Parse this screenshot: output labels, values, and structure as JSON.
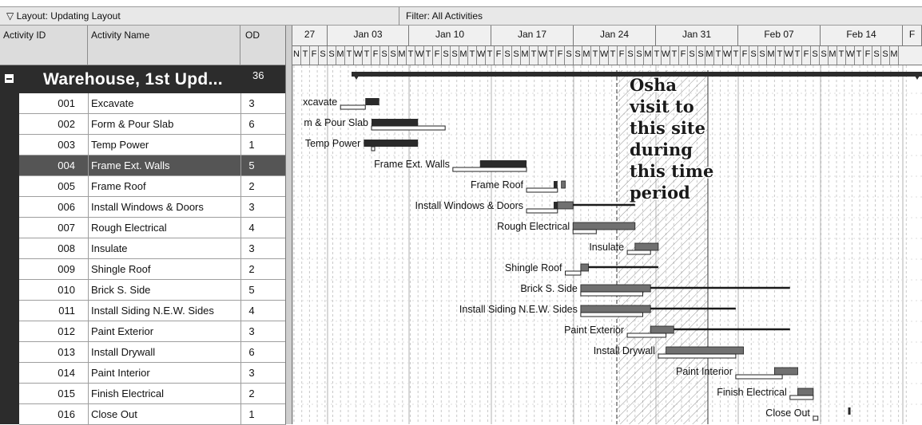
{
  "toolbar": {
    "layout_label": "Layout: Updating Layout",
    "filter_label": "Filter: All Activities"
  },
  "columns": {
    "activity_id": "Activity ID",
    "activity_name": "Activity Name",
    "od": "OD"
  },
  "wbs": {
    "name": "Warehouse, 1st Upd...",
    "od": "36"
  },
  "activities": [
    {
      "id": "001",
      "name": "Excavate",
      "od": "3",
      "bar_label": "xcavate"
    },
    {
      "id": "002",
      "name": "Form & Pour Slab",
      "od": "6",
      "bar_label": "m & Pour Slab"
    },
    {
      "id": "003",
      "name": "Temp Power",
      "od": "1",
      "bar_label": "Temp Power"
    },
    {
      "id": "004",
      "name": "Frame Ext. Walls",
      "od": "5",
      "bar_label": "Frame Ext. Walls"
    },
    {
      "id": "005",
      "name": "Frame Roof",
      "od": "2",
      "bar_label": "Frame Roof"
    },
    {
      "id": "006",
      "name": "Install Windows & Doors",
      "od": "3",
      "bar_label": "Install Windows & Doors"
    },
    {
      "id": "007",
      "name": "Rough Electrical",
      "od": "4",
      "bar_label": "Rough Electrical"
    },
    {
      "id": "008",
      "name": "Insulate",
      "od": "3",
      "bar_label": "Insulate"
    },
    {
      "id": "009",
      "name": "Shingle Roof",
      "od": "2",
      "bar_label": "Shingle Roof"
    },
    {
      "id": "010",
      "name": "Brick S. Side",
      "od": "5",
      "bar_label": "Brick S. Side"
    },
    {
      "id": "011",
      "name": "Install Siding N.E.W. Sides",
      "od": "4",
      "bar_label": "Install Siding N.E.W. Sides"
    },
    {
      "id": "012",
      "name": "Paint Exterior",
      "od": "3",
      "bar_label": "Paint Exterior"
    },
    {
      "id": "013",
      "name": "Install Drywall",
      "od": "6",
      "bar_label": "Install Drywall"
    },
    {
      "id": "014",
      "name": "Paint Interior",
      "od": "3",
      "bar_label": "Paint Interior"
    },
    {
      "id": "015",
      "name": "Finish Electrical",
      "od": "2",
      "bar_label": "Finish Electrical"
    },
    {
      "id": "016",
      "name": "Close Out",
      "od": "1",
      "bar_label": "Close Out"
    }
  ],
  "selected_activity": "004",
  "timescale": {
    "weeks": [
      "27",
      "Jan 03",
      "Jan 10",
      "Jan 17",
      "Jan 24",
      "Jan 31",
      "Feb 07",
      "Feb 14",
      "F"
    ],
    "day_letters": [
      "N",
      "T",
      "F",
      "S",
      "S",
      "M",
      "T",
      "W",
      "T",
      "F",
      "S",
      "S",
      "M",
      "T",
      "W",
      "T",
      "F",
      "S",
      "S",
      "M",
      "T",
      "W",
      "T",
      "F",
      "S",
      "S",
      "M",
      "T",
      "W",
      "T",
      "F",
      "S",
      "S",
      "M",
      "T",
      "W",
      "T",
      "F",
      "S",
      "S",
      "M",
      "T",
      "W",
      "T",
      "F",
      "S",
      "S",
      "M",
      "T",
      "W",
      "T",
      "F",
      "S",
      "S",
      "M",
      "T",
      "W",
      "T",
      "F",
      "S",
      "S",
      "M",
      "T",
      "W",
      "T",
      "F",
      "S",
      "S",
      "M"
    ]
  },
  "annotation": {
    "lines": [
      "Osha",
      "visit to",
      "this site",
      "during",
      "this time",
      "period"
    ]
  },
  "colors": {
    "wbs_bar": "#2c2c2c",
    "actual_bar": "#2a2a2a",
    "remaining_bar": "#707070",
    "baseline_bar": "#ffffff",
    "float_line": "#1a1a1a",
    "selected_row": "#555555"
  },
  "bar_schedule_days": [
    {
      "a": [
        9.2,
        11
      ],
      "b": [
        6,
        9.2
      ],
      "float": null
    },
    {
      "a": [
        10,
        16
      ],
      "b": [
        10,
        19.5
      ],
      "float": null
    },
    {
      "a": [
        9,
        16
      ],
      "b": [
        10,
        10.4
      ],
      "float": null
    },
    {
      "a": [
        24,
        30
      ],
      "b": [
        20.5,
        30
      ],
      "float": null
    },
    {
      "a": [
        33.5,
        34
      ],
      "b": [
        30,
        34
      ],
      "rem": [
        34.5,
        35
      ],
      "float": null
    },
    {
      "a": [
        33.5,
        34
      ],
      "b": [
        30,
        34
      ],
      "rem": [
        34,
        36
      ],
      "float": [
        36,
        44
      ]
    },
    {
      "a": null,
      "b": [
        36,
        39
      ],
      "rem": [
        36,
        44
      ],
      "float": null
    },
    {
      "a": null,
      "b": [
        43,
        46
      ],
      "rem": [
        44,
        47
      ],
      "float": null
    },
    {
      "a": null,
      "b": [
        35,
        37
      ],
      "rem": [
        37,
        38
      ],
      "float": [
        38,
        47
      ]
    },
    {
      "a": null,
      "b": [
        37,
        45
      ],
      "rem": [
        37,
        46
      ],
      "float": [
        46,
        64
      ]
    },
    {
      "a": null,
      "b": [
        37,
        45
      ],
      "rem": [
        37,
        46
      ],
      "float": [
        46,
        57
      ]
    },
    {
      "a": null,
      "b": [
        43,
        48
      ],
      "rem": [
        46,
        49
      ],
      "float": [
        49,
        64
      ]
    },
    {
      "a": null,
      "b": [
        47,
        57
      ],
      "rem": [
        48,
        58
      ],
      "float": null
    },
    {
      "a": null,
      "b": [
        57,
        63
      ],
      "rem": [
        62,
        65
      ],
      "float": null
    },
    {
      "a": null,
      "b": [
        64,
        67
      ],
      "rem": [
        65,
        67
      ],
      "float": null
    },
    {
      "a": null,
      "b": [
        67,
        67.6
      ],
      "rem": null,
      "float": null,
      "tick": 71.5
    }
  ]
}
